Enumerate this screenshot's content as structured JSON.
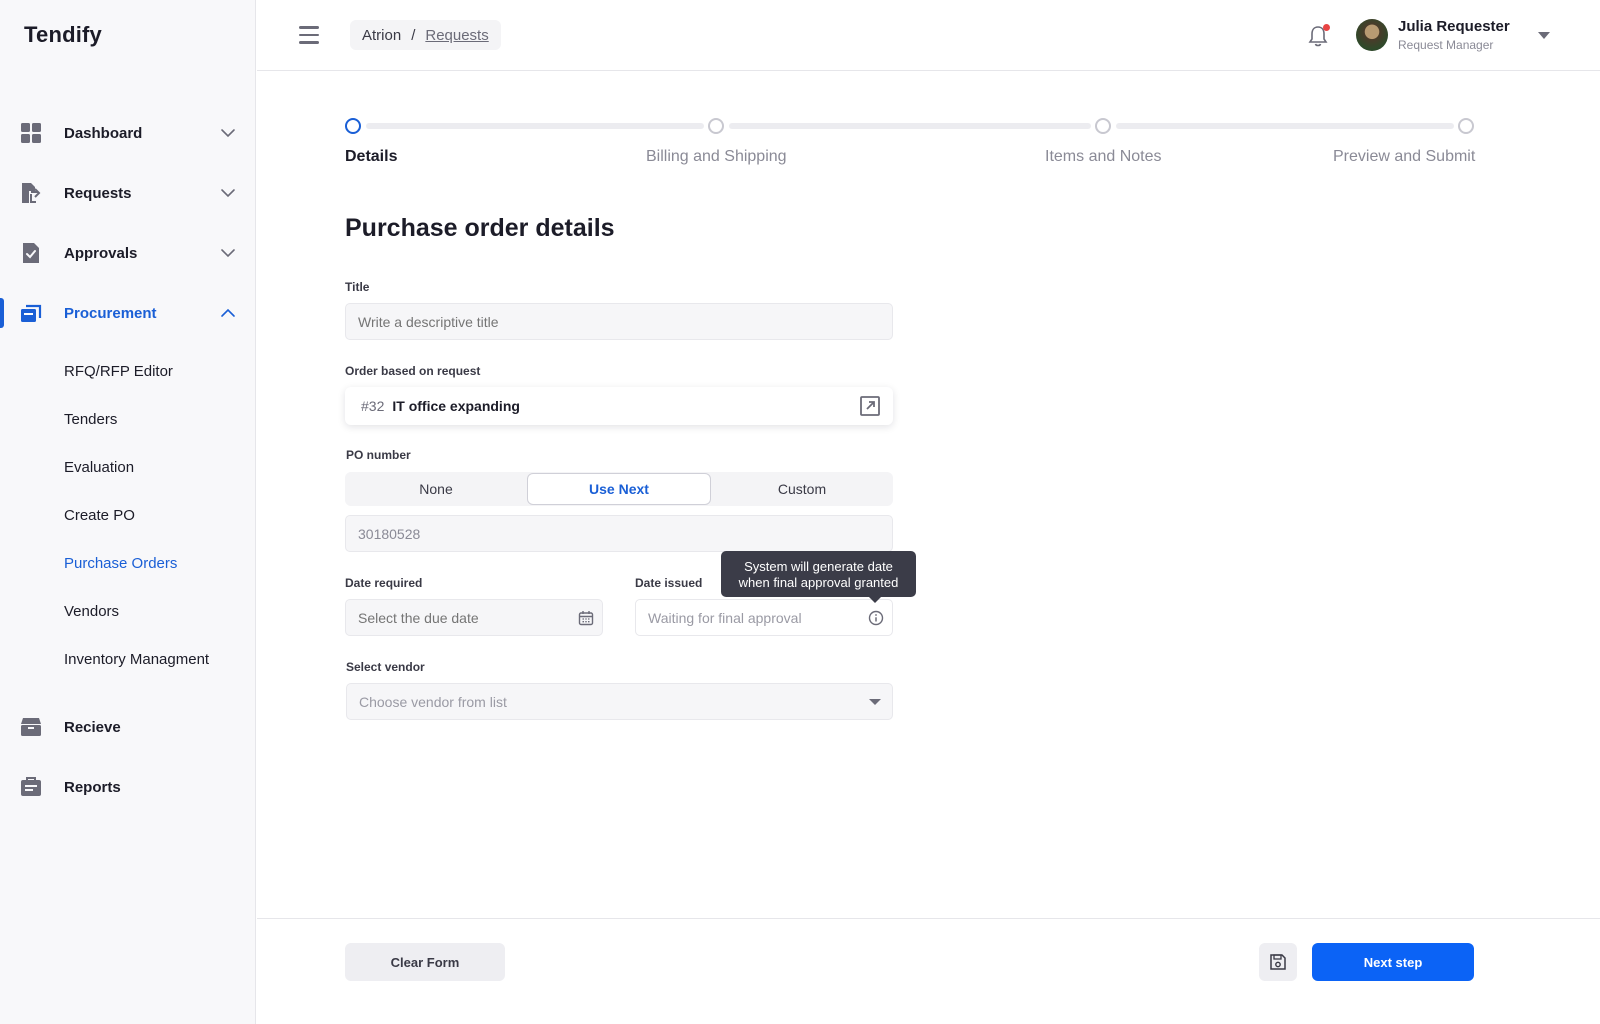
{
  "app": {
    "logo": "Tendify"
  },
  "colors": {
    "accent": "#1a5fd6",
    "primary_button": "#0b63f6",
    "notification_dot": "#e84343",
    "tooltip_bg": "#3b3c48"
  },
  "sidebar": {
    "items": [
      {
        "label": "Dashboard",
        "icon": "dashboard-grid-icon",
        "expanded": false
      },
      {
        "label": "Requests",
        "icon": "request-document-icon",
        "expanded": false
      },
      {
        "label": "Approvals",
        "icon": "approval-check-icon",
        "expanded": false
      },
      {
        "label": "Procurement",
        "icon": "procurement-icon",
        "expanded": true,
        "active": true
      },
      {
        "label": "Recieve",
        "icon": "receive-box-icon",
        "expanded": false
      },
      {
        "label": "Reports",
        "icon": "reports-icon",
        "expanded": false
      }
    ],
    "procurement_sub": [
      {
        "label": "RFQ/RFP Editor"
      },
      {
        "label": "Tenders"
      },
      {
        "label": "Evaluation"
      },
      {
        "label": "Create PO"
      },
      {
        "label": "Purchase Orders",
        "active": true
      },
      {
        "label": "Vendors"
      },
      {
        "label": "Inventory Managment"
      }
    ]
  },
  "header": {
    "breadcrumb": [
      "Atrion",
      "Requests"
    ],
    "breadcrumb_separator": "/",
    "user": {
      "name": "Julia Requester",
      "role": "Request Manager"
    },
    "has_notification": true
  },
  "stepper": {
    "current": 0,
    "steps": [
      "Details",
      "Billing and Shipping",
      "Items and Notes",
      "Preview and Submit"
    ]
  },
  "form": {
    "title": "Purchase order details",
    "title_field": {
      "label": "Title",
      "placeholder": "Write a descriptive title"
    },
    "order_based": {
      "label": "Order based on request",
      "number": "#32",
      "title": "IT office expanding"
    },
    "po_number": {
      "label": "PO number",
      "options": [
        "None",
        "Use Next",
        "Custom"
      ],
      "selected": "Use Next",
      "value": "30180528"
    },
    "date_required": {
      "label": "Date required",
      "placeholder": "Select the due date"
    },
    "date_issued": {
      "label": "Date issued",
      "value": "Waiting for final approval",
      "tooltip_line1": "System will generate date",
      "tooltip_line2": "when final approval granted"
    },
    "vendor": {
      "label": "Select vendor",
      "placeholder": "Choose vendor from list"
    }
  },
  "footer": {
    "clear_label": "Clear Form",
    "next_label": "Next step"
  }
}
